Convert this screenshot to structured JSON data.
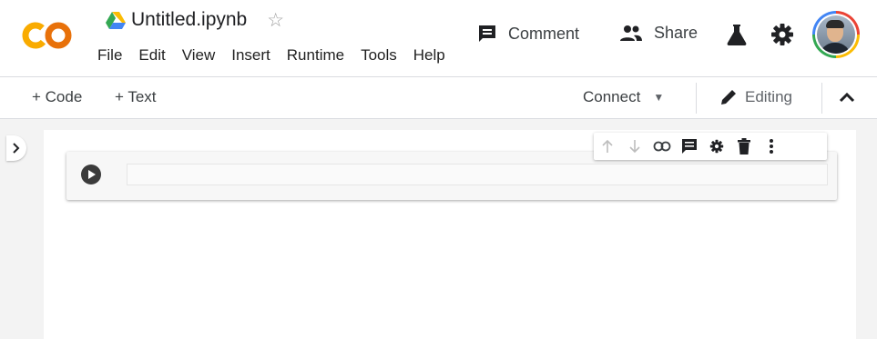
{
  "document": {
    "title": "Untitled.ipynb"
  },
  "menu": [
    "File",
    "Edit",
    "View",
    "Insert",
    "Runtime",
    "Tools",
    "Help"
  ],
  "header_actions": {
    "comment": "Comment",
    "share": "Share"
  },
  "toolbar": {
    "add_code": "+ Code",
    "add_text": "+ Text",
    "connect": "Connect",
    "mode": "Editing"
  },
  "icons": {
    "logo": "colab-logo",
    "drive": "google-drive-icon",
    "star": "star-outline-icon",
    "comment": "comment-icon",
    "share": "people-icon",
    "labs": "flask-icon",
    "settings": "gear-icon",
    "cell_toolbar": [
      "arrow-up-icon",
      "arrow-down-icon",
      "link-icon",
      "comment-icon",
      "gear-icon",
      "trash-icon",
      "more-vert-icon"
    ]
  },
  "colors": {
    "logo_orange": "#F9AB00",
    "logo_amber": "#E8710A",
    "background": "#F3F3F3",
    "accent_blue": "#4285F4"
  }
}
